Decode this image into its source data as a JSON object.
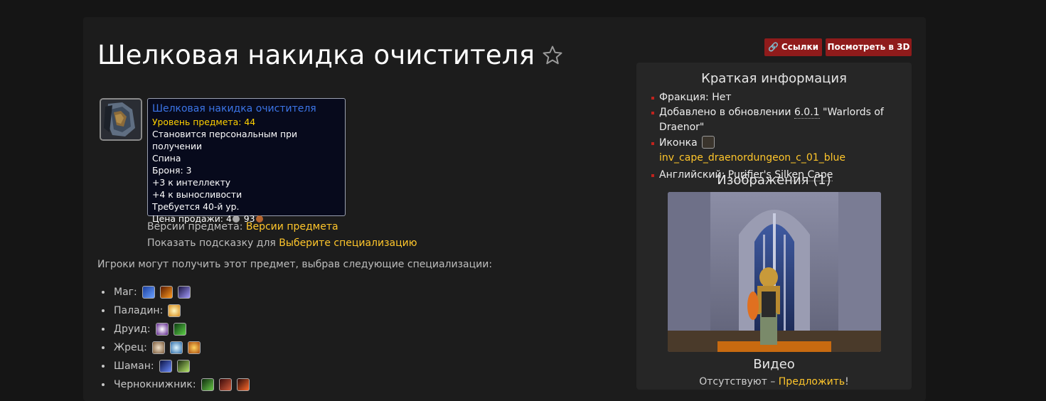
{
  "page": {
    "title": "Шелковая накидка очистителя"
  },
  "toolbar": {
    "links_label": "Ссылки",
    "view3d_label": "Посмотреть в 3D"
  },
  "tooltip": {
    "name": "Шелковая накидка очистителя",
    "item_level": "Уровень предмета: 44",
    "binding": "Становится персональным при получении",
    "slot": "Спина",
    "armor": "Броня: 3",
    "stat1": "+3 к интеллекту",
    "stat2": "+4 к выносливости",
    "requires": "Требуется 40-й ур.",
    "sell_label": "Цена продажи:",
    "sell_silver": "4",
    "sell_copper": "93"
  },
  "meta": {
    "versions_label": "Версии предмета:",
    "versions_link": "Версии предмета",
    "tooltip_for_label": "Показать подсказку для",
    "tooltip_for_link": "Выберите специализацию"
  },
  "players_text": "Игроки могут получить этот предмет, выбрав следующие специализации:",
  "specs": [
    {
      "class": "Маг:",
      "icons": [
        "arcane-icon",
        "fire-icon",
        "frost-icon"
      ]
    },
    {
      "class": "Паладин:",
      "icons": [
        "holy-light-icon"
      ]
    },
    {
      "class": "Друид:",
      "icons": [
        "balance-icon",
        "restoration-icon"
      ]
    },
    {
      "class": "Жрец:",
      "icons": [
        "discipline-icon",
        "holy-icon",
        "shadow-icon"
      ]
    },
    {
      "class": "Шаман:",
      "icons": [
        "elemental-icon",
        "restoration-shaman-icon"
      ]
    },
    {
      "class": "Чернокнижник:",
      "icons": [
        "affliction-icon",
        "demonology-icon",
        "destruction-icon"
      ]
    }
  ],
  "sidebar": {
    "info_title": "Краткая информация",
    "faction_label": "Фракция:",
    "faction_value": "Нет",
    "added_label": "Добавлено в обновлении",
    "added_version": "6.0.1",
    "added_name": "\"Warlords of Draenor\"",
    "icon_label": "Иконка",
    "icon_name": "inv_cape_draenordungeon_c_01_blue",
    "english_label": "Английский:",
    "english_value": "Purifier's Silken Cape",
    "images_title": "Изображения (1)",
    "video_title": "Видео",
    "video_none": "Отсутствуют –",
    "video_suggest": "Предложить",
    "video_end": "!"
  },
  "colors": {
    "accent_red": "#8f1b1b",
    "link_gold": "#ffc62b",
    "item_blue": "#3b74e6",
    "ilvl_yellow": "#ffd100"
  }
}
